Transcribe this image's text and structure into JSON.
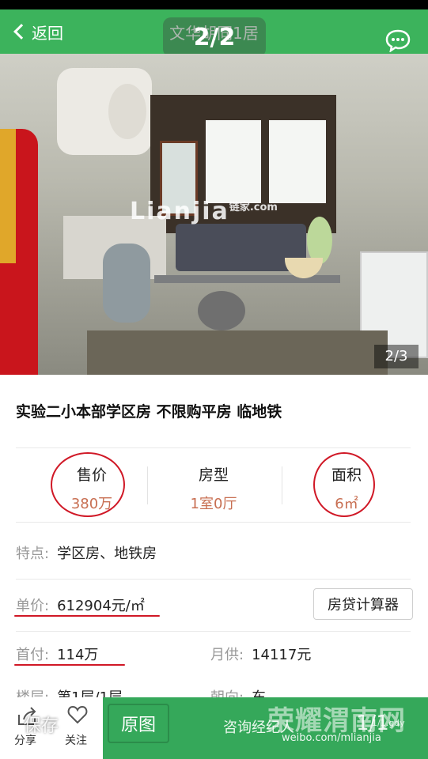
{
  "header": {
    "back_label": "返回",
    "title": "文华胡同1居",
    "pager": "2/2"
  },
  "photo": {
    "watermark": "Lianjia",
    "watermark_cn": "链家",
    "watermark_domain": ".com",
    "counter": "2/3"
  },
  "listing": {
    "title": "实验二小本部学区房 不限购平房 临地铁",
    "stats": [
      {
        "label": "售价",
        "value": "380万"
      },
      {
        "label": "房型",
        "value": "1室0厅"
      },
      {
        "label": "面积",
        "value": "6㎡"
      }
    ],
    "features_key": "特点:",
    "features_value": "学区房、地铁房",
    "unit_price_key": "单价:",
    "unit_price_value": "612904元/㎡",
    "calc_button": "房贷计算器",
    "down_payment_key": "首付:",
    "down_payment_value": "114万",
    "monthly_key": "月供:",
    "monthly_value": "14117元",
    "floor_key": "楼层:",
    "floor_value": "第1层/1层",
    "orientation_key": "朝向:",
    "orientation_value": "东"
  },
  "bottom_bar": {
    "share_label": "分享",
    "follow_label": "关注",
    "save_overlay": "保存",
    "original_button": "原图",
    "consult_button": "咨询经纪人",
    "overlay_counter": "1/1",
    "brand_watermark": "荣耀渭南网",
    "weibo_watermark": "weibo.com/mlianjia",
    "small_watermark": "1/1.gdy"
  },
  "colors": {
    "brand_green": "#3cb35c",
    "price_orange": "#c86f52",
    "annotation_red": "#d01826"
  }
}
